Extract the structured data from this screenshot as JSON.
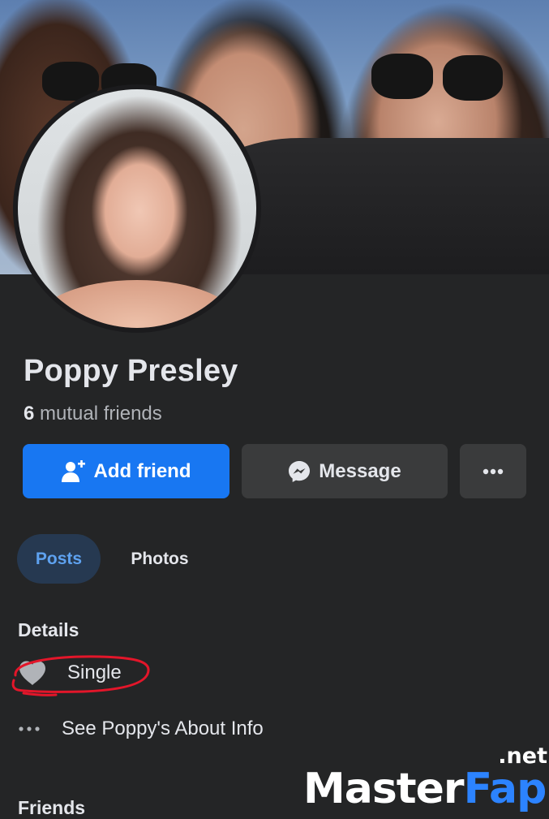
{
  "profile": {
    "name": "Poppy Presley",
    "mutual_count": "6",
    "mutual_label": "mutual friends"
  },
  "actions": {
    "add_friend_label": "Add friend",
    "message_label": "Message",
    "more_icon": "more-dots-icon"
  },
  "tabs": [
    {
      "label": "Posts",
      "active": true
    },
    {
      "label": "Photos",
      "active": false
    }
  ],
  "details": {
    "title": "Details",
    "relationship": "Single",
    "about_link": "See Poppy's About Info"
  },
  "friends": {
    "title": "Friends"
  },
  "watermark": {
    "main": "Master",
    "accent": "Fap",
    "suffix": ".net"
  },
  "colors": {
    "background": "#242526",
    "primary_button": "#1877f2",
    "secondary_button": "#3a3b3c",
    "active_tab_bg": "#263951",
    "active_tab_text": "#5ea2f0",
    "annotation": "#e3162a"
  }
}
